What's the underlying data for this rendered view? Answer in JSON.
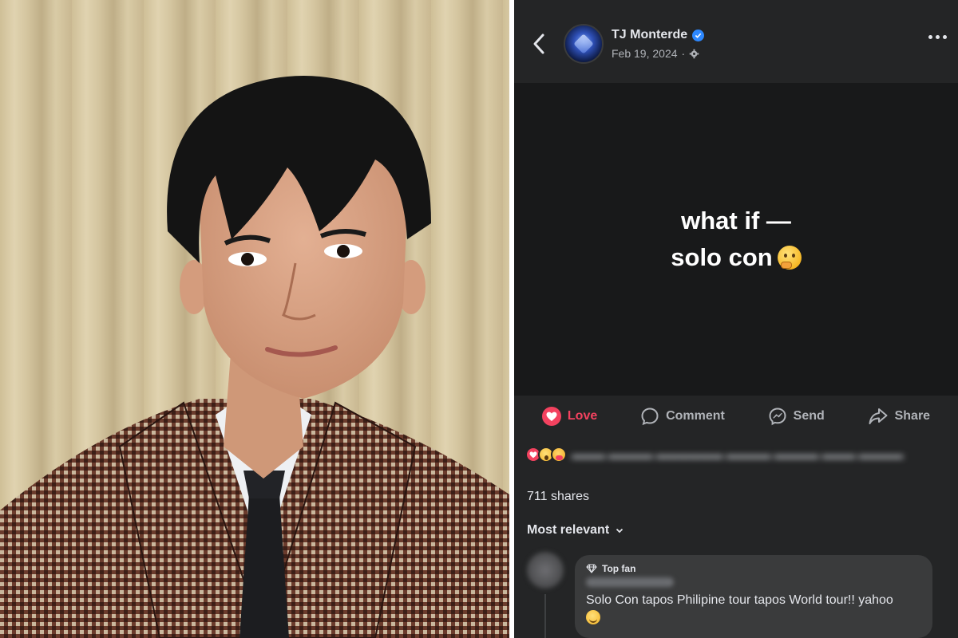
{
  "post": {
    "author": "TJ Monterde",
    "date": "Feb 19, 2024",
    "separator": "·",
    "line1": "what if —",
    "line2": "solo con"
  },
  "actions": {
    "love": "Love",
    "comment": "Comment",
    "send": "Send",
    "share": "Share"
  },
  "stats": {
    "shares": "711 shares"
  },
  "comments": {
    "sort_label": "Most relevant",
    "items": [
      {
        "badge": "Top fan",
        "text": "Solo Con tapos Philipine tour tapos World tour!! yahoo"
      }
    ]
  },
  "icons": [
    "back-icon",
    "verified-icon",
    "privacy-gear-icon",
    "more-icon",
    "love-icon",
    "comment-icon",
    "messenger-icon",
    "share-icon",
    "chevron-down-icon",
    "diamond-icon"
  ],
  "colors": {
    "background": "#242526",
    "media_background": "#18191a",
    "love": "#f3425f",
    "verified": "#2d88ff",
    "text_primary": "#e4e6eb",
    "text_secondary": "#b0b3b8",
    "bubble": "#3a3b3c"
  }
}
